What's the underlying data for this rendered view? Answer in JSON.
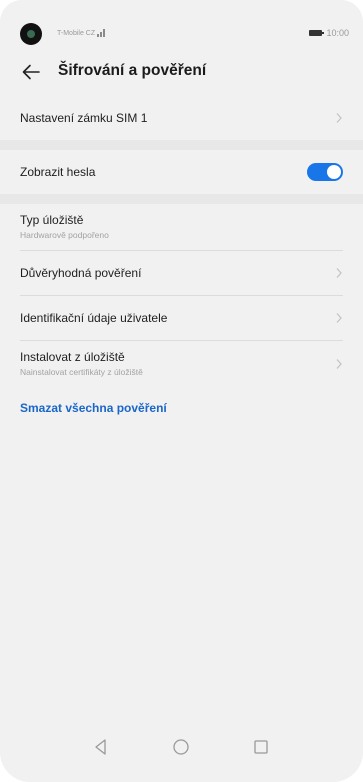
{
  "status_bar": {
    "carrier": "T-Mobile CZ",
    "time": "10:00",
    "icons": [
      "camera-hole",
      "signal-icon",
      "battery-icon"
    ]
  },
  "header": {
    "back_icon": "arrow-left-icon",
    "title": "Šifrování a pověření"
  },
  "settings": {
    "sim_lock": {
      "title": "Nastavení zámku SIM 1"
    },
    "show_passwords": {
      "title": "Zobrazit hesla",
      "toggle_on": true
    },
    "storage_type": {
      "title": "Typ úložiště",
      "subtitle": "Hardwarově podpořeno"
    },
    "trusted_credentials": {
      "title": "Důvěryhodná pověření"
    },
    "user_credentials": {
      "title": "Identifikační údaje uživatele"
    },
    "install_from_storage": {
      "title": "Instalovat z úložiště",
      "subtitle": "Nainstalovat certifikáty z úložiště"
    },
    "clear_credentials": {
      "label": "Smazat všechna pověření"
    }
  },
  "nav_bar": {
    "buttons": [
      "back-triangle-icon",
      "home-circle-icon",
      "recents-square-icon"
    ]
  },
  "colors": {
    "background": "#f1f1f1",
    "accent": "#1976e8",
    "link": "#1a66c9",
    "text_primary": "#1e1e1e",
    "text_secondary": "#a2a2a2",
    "divider": "#dcdcdc"
  }
}
